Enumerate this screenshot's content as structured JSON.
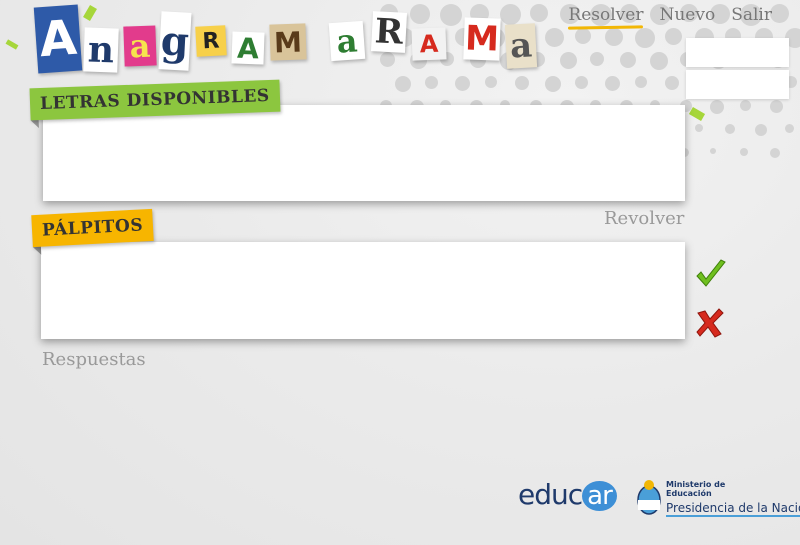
{
  "app": {
    "title_letters": [
      "A",
      "n",
      "a",
      "g",
      "R",
      "A",
      "M",
      "a",
      "R",
      "A",
      "M",
      "a"
    ]
  },
  "nav": {
    "items": [
      {
        "label": "Resolver",
        "active": true
      },
      {
        "label": "Nuevo",
        "active": false
      },
      {
        "label": "Salir",
        "active": false
      }
    ]
  },
  "available": {
    "title": "LETRAS DISPONIBLES",
    "shuffle_label": "Revolver"
  },
  "guesses": {
    "title": "PÁLPITOS",
    "answers_label": "Respuestas",
    "accept_icon": "checkmark-icon",
    "reject_icon": "x-icon"
  },
  "footer": {
    "educar_prefix": "educ",
    "educar_suffix": "ar",
    "ministry_line1": "Ministerio de",
    "ministry_line2": "Educación",
    "ministry_line3": "Presidencia de la Nación"
  },
  "colors": {
    "green_tag": "#8cc63f",
    "yellow_tag": "#f7b500",
    "accent_underline": "#f2b705",
    "check_green": "#6fbf1f",
    "cross_red": "#d62a1e"
  }
}
